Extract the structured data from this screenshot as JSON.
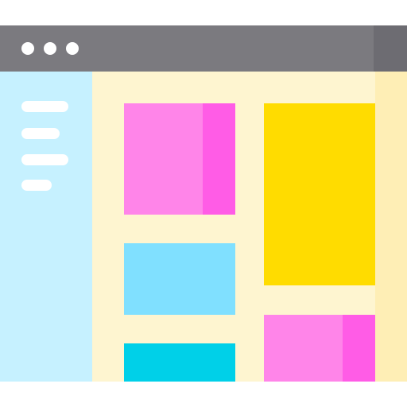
{
  "colors": {
    "titlebar": "#7b7a7f",
    "titlebar_end": "#6d6c72",
    "window_dots": "#ffffff",
    "sidebar": "#c6f1ff",
    "sidebar_lines": "#ffffff",
    "content_bg": "#fef5d0",
    "scroll_strip": "#feeeb5",
    "tile_pink": "#ff85e9",
    "tile_pink_shade": "#ff5ce6",
    "tile_yellow": "#ffdc00",
    "tile_light_blue": "#80e0ff",
    "tile_cyan": "#00d0e8"
  },
  "window_controls": [
    "dot-icon",
    "dot-icon",
    "dot-icon"
  ],
  "sidebar": {
    "menu_lines": 4
  },
  "content": {
    "tiles": [
      "pink-card",
      "yellow-card",
      "light-blue-card",
      "pink-card",
      "cyan-card"
    ]
  }
}
